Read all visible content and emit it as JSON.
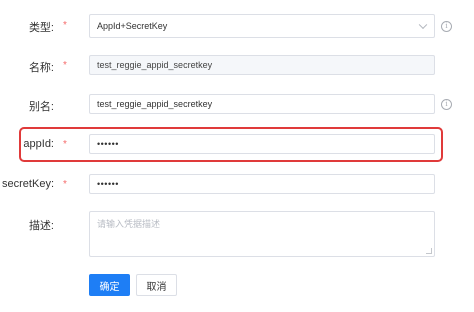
{
  "form": {
    "type": {
      "label": "类型:",
      "required_mark": "*",
      "value": "AppId+SecretKey",
      "info_icon": "i"
    },
    "name": {
      "label": "名称:",
      "required_mark": "*",
      "value": "test_reggie_appid_secretkey"
    },
    "alias": {
      "label": "别名:",
      "value": "test_reggie_appid_secretkey",
      "info_icon": "i"
    },
    "appid": {
      "label": "appId:",
      "required_mark": "*",
      "value": "••••••"
    },
    "secretkey": {
      "label": "secretKey:",
      "required_mark": "*",
      "value": "••••••"
    },
    "description": {
      "label": "描述:",
      "placeholder": "请输入凭据描述"
    }
  },
  "actions": {
    "confirm_label": "确定",
    "cancel_label": "取消"
  },
  "colors": {
    "primary": "#1e7ef5",
    "required": "#f56c6c",
    "highlight_border": "#e03a3a"
  }
}
